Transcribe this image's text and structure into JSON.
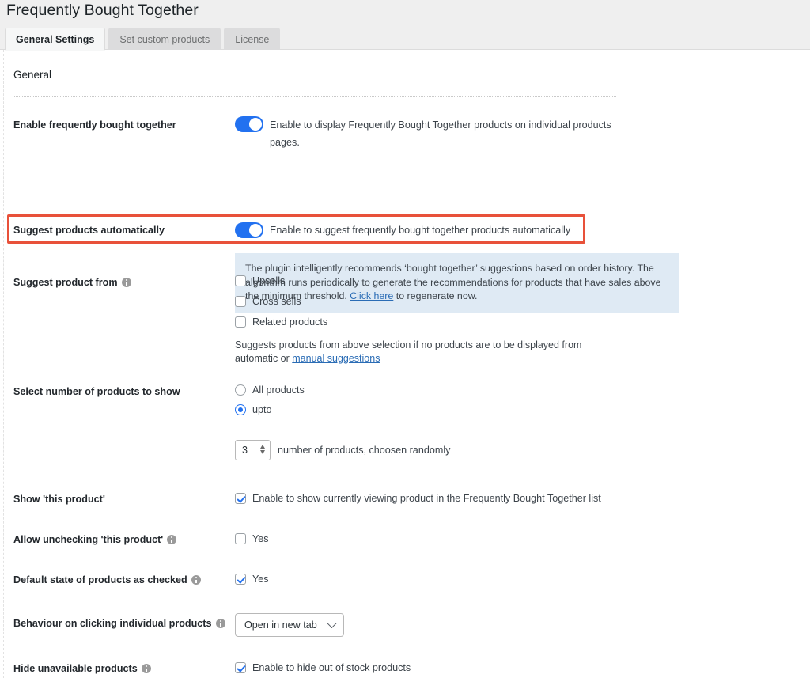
{
  "header": {
    "title": "Frequently Bought Together",
    "tabs": [
      {
        "label": "General Settings",
        "active": true
      },
      {
        "label": "Set custom products",
        "active": false
      },
      {
        "label": "License",
        "active": false
      }
    ]
  },
  "colors": {
    "accent": "#2271f0",
    "highlight_border": "#e8513a",
    "notice_bg": "#dfeaf4",
    "header_bg": "#efefef",
    "link": "#2a6cb5"
  },
  "section": {
    "title": "General"
  },
  "rows": {
    "enable_fbt": {
      "label": "Enable frequently bought together",
      "toggle_on": true,
      "description": "Enable to display Frequently Bought Together products on individual products pages."
    },
    "suggest_auto": {
      "label": "Suggest products automatically",
      "toggle_on": true,
      "description": "Enable to suggest frequently bought together products automatically",
      "highlighted": true
    },
    "notice": {
      "text_before_link": "The plugin intelligently recommends ‘bought together’ suggestions based on order history. The algorithm runs periodically to generate the recommendations for products that have sales above the minimum threshold. ",
      "link_text": "Click here",
      "text_after_link": " to regenerate now."
    },
    "suggest_from": {
      "label": "Suggest product from",
      "has_info_icon": true,
      "options": [
        {
          "label": "Upsells",
          "checked": false
        },
        {
          "label": "Cross sells",
          "checked": false
        },
        {
          "label": "Related products",
          "checked": false
        }
      ],
      "helper_before_link": "Suggests products from above selection if no products are to be displayed from automatic or ",
      "helper_link": "manual suggestions"
    },
    "number_to_show": {
      "label": "Select number of products to show",
      "radios": [
        {
          "label": "All products",
          "selected": false
        },
        {
          "label": "upto",
          "selected": true
        }
      ],
      "spinner_value": "3",
      "spinner_suffix": "number of products, choosen randomly"
    },
    "show_this_product": {
      "label": "Show 'this product'",
      "has_info_icon": false,
      "checkbox_label": "Enable to show currently viewing product in the Frequently Bought Together list",
      "checked": true
    },
    "allow_unchecking": {
      "label": "Allow unchecking 'this product'",
      "has_info_icon": true,
      "checkbox_label": "Yes",
      "checked": false
    },
    "default_checked": {
      "label": "Default state of products as checked",
      "has_info_icon": true,
      "checkbox_label": "Yes",
      "checked": true
    },
    "behaviour_click": {
      "label": "Behaviour on clicking individual products",
      "has_info_icon": true,
      "selected_option": "Open in new tab"
    },
    "hide_unavailable": {
      "label": "Hide unavailable products",
      "has_info_icon": true,
      "checkbox_label": "Enable to hide out of stock products",
      "checked": true
    }
  }
}
